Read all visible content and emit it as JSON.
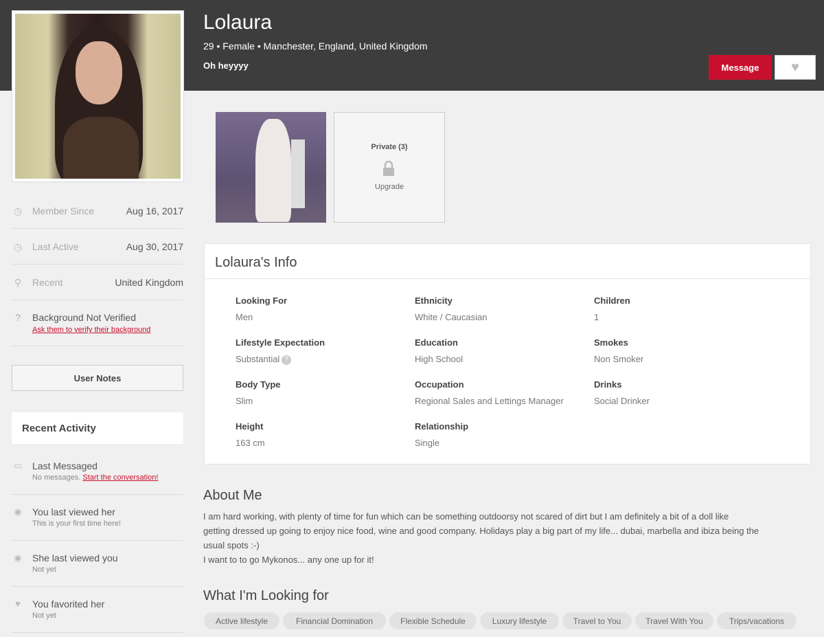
{
  "profile": {
    "name": "Lolaura",
    "subline": "29 • Female • Manchester, England, United Kingdom",
    "tagline": "Oh heyyyy"
  },
  "actions": {
    "message_label": "Message",
    "favorite_icon": "heart-icon"
  },
  "sidebar": {
    "member_since": {
      "label": "Member Since",
      "value": "Aug 16, 2017",
      "icon": "clock-icon"
    },
    "last_active": {
      "label": "Last Active",
      "value": "Aug 30, 2017",
      "icon": "clock-icon"
    },
    "location": {
      "label": "Recent",
      "value": "United Kingdom",
      "icon": "map-pin-icon"
    },
    "verification": {
      "title": "Background Not Verified",
      "link": "Ask them to verify their background",
      "icon": "help-circle-icon"
    },
    "user_notes_label": "User Notes"
  },
  "recent_activity": {
    "title": "Recent Activity",
    "items": [
      {
        "title": "Last Messaged",
        "sub": "No messages.",
        "link": "Start the conversation!",
        "icon": "chat-icon"
      },
      {
        "title": "You last viewed her",
        "sub": "This is your first time here!",
        "icon": "eye-icon"
      },
      {
        "title": "She last viewed you",
        "sub": "Not yet",
        "icon": "eye-icon"
      },
      {
        "title": "You favorited her",
        "sub": "Not yet",
        "icon": "heart-icon"
      }
    ]
  },
  "gallery": {
    "private_label": "Private (3)",
    "upgrade_label": "Upgrade"
  },
  "info": {
    "title": "Lolaura's Info",
    "fields": [
      {
        "label": "Looking For",
        "value": "Men"
      },
      {
        "label": "Ethnicity",
        "value": "White / Caucasian"
      },
      {
        "label": "Children",
        "value": "1"
      },
      {
        "label": "Lifestyle Expectation",
        "value": "Substantial"
      },
      {
        "label": "Education",
        "value": "High School"
      },
      {
        "label": "Smokes",
        "value": "Non Smoker"
      },
      {
        "label": "Body Type",
        "value": "Slim"
      },
      {
        "label": "Occupation",
        "value": "Regional Sales and Lettings Manager"
      },
      {
        "label": "Drinks",
        "value": "Social Drinker"
      },
      {
        "label": "Height",
        "value": "163 cm"
      },
      {
        "label": "Relationship",
        "value": "Single"
      }
    ]
  },
  "about": {
    "title": "About Me",
    "lines": [
      "I am hard working, with plenty of time for fun which can be something outdoorsy not scared of dirt but I am definitely a bit of a doll like",
      "getting dressed up going to enjoy nice food, wine and good company. Holidays play a big part of my life... dubai, marbella and ibiza being the",
      "usual spots :-)",
      "I want to to go Mykonos... any one up for it!"
    ]
  },
  "looking_for": {
    "title": "What I'm Looking for",
    "tags": [
      "Active lifestyle",
      "Financial Domination",
      "Flexible Schedule",
      "Luxury lifestyle",
      "Travel to You",
      "Travel With You",
      "Trips/vacations"
    ]
  },
  "colors": {
    "header": "#3d3d3d",
    "accent": "#c8102e",
    "background": "#f0f0f0"
  }
}
